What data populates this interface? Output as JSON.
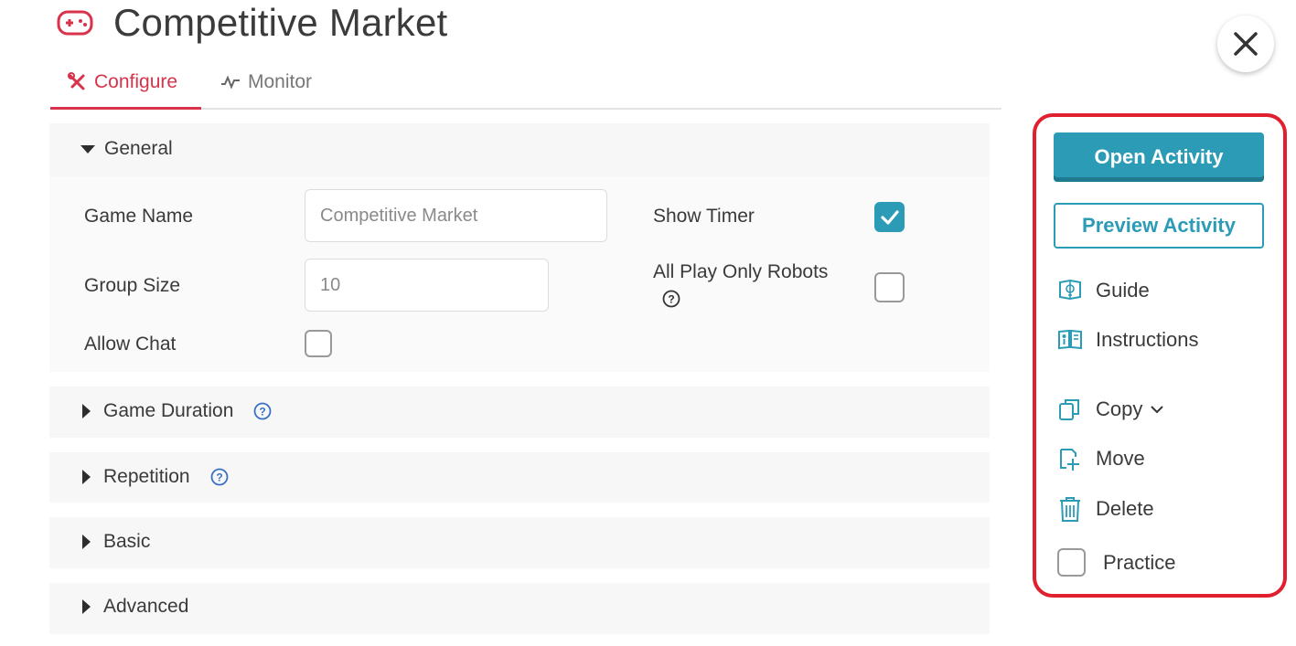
{
  "header": {
    "title": "Competitive Market",
    "icon": "gamepad-icon"
  },
  "tabs": [
    {
      "label": "Configure",
      "icon": "tools-icon",
      "active": true
    },
    {
      "label": "Monitor",
      "icon": "activity-icon",
      "active": false
    }
  ],
  "sections": {
    "general": {
      "title": "General",
      "expanded": true,
      "fields": {
        "game_name_label": "Game Name",
        "game_name_value": "Competitive Market",
        "group_size_label": "Group Size",
        "group_size_value": "10",
        "allow_chat_label": "Allow Chat",
        "allow_chat_checked": false,
        "show_timer_label": "Show Timer",
        "show_timer_checked": true,
        "all_play_robots_label": "All Play Only Robots",
        "all_play_robots_checked": false
      }
    },
    "game_duration": {
      "title": "Game Duration",
      "expanded": false
    },
    "repetition": {
      "title": "Repetition",
      "expanded": false
    },
    "basic": {
      "title": "Basic",
      "expanded": false
    },
    "advanced": {
      "title": "Advanced",
      "expanded": false
    }
  },
  "actions": {
    "open_activity": "Open Activity",
    "preview_activity": "Preview Activity",
    "guide": "Guide",
    "instructions": "Instructions",
    "copy": "Copy",
    "move": "Move",
    "delete": "Delete",
    "practice": "Practice",
    "practice_checked": false
  },
  "colors": {
    "accent_red": "#d8334a",
    "primary_teal": "#2b9bb6",
    "highlight_border": "#e0202e"
  }
}
